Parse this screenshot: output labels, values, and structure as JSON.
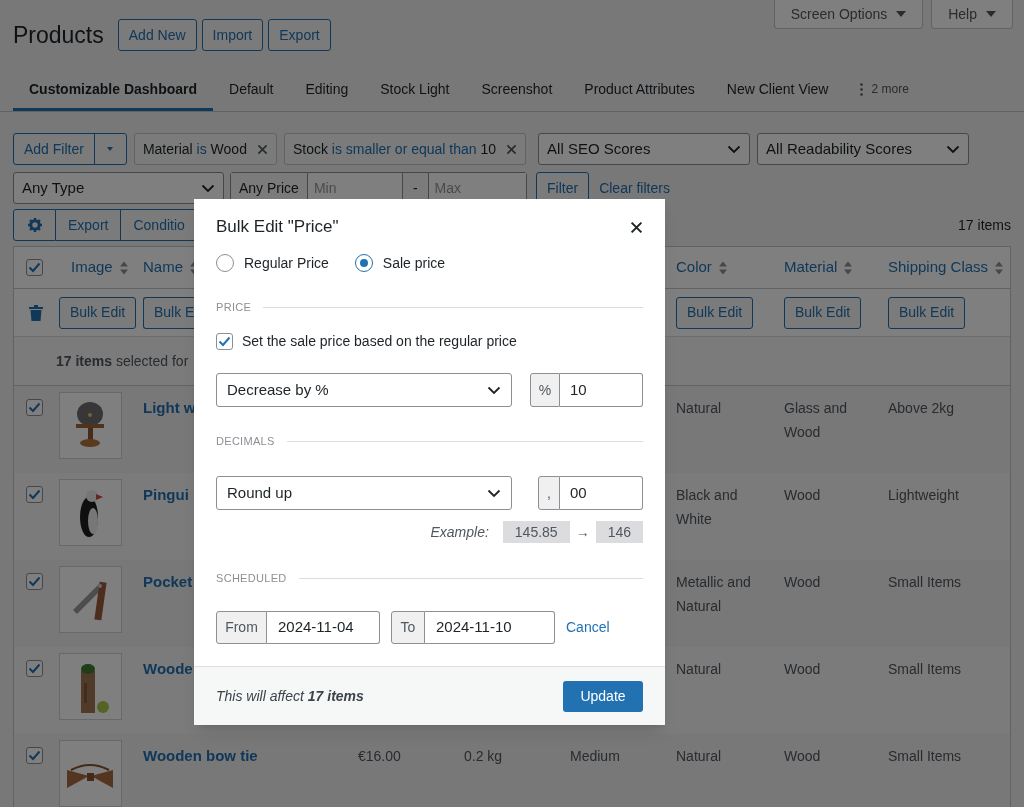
{
  "page_title": "Products",
  "header_buttons": [
    "Add New",
    "Import",
    "Export"
  ],
  "screen_meta_buttons": [
    "Screen Options",
    "Help"
  ],
  "tabs": [
    {
      "label": "Customizable Dashboard",
      "selected": true
    },
    {
      "label": "Default",
      "selected": false
    },
    {
      "label": "Editing",
      "selected": false
    },
    {
      "label": "Stock Light",
      "selected": false
    },
    {
      "label": "Screenshot",
      "selected": false
    },
    {
      "label": "Product Attributes",
      "selected": false
    },
    {
      "label": "New Client View",
      "selected": false
    }
  ],
  "more_tabs": "2 more",
  "filters": {
    "add_filter": "Add Filter",
    "chips": [
      {
        "field": "Material",
        "operator": "is",
        "value": "Wood"
      },
      {
        "field": "Stock",
        "operator": "is smaller or equal than",
        "value": "10"
      }
    ],
    "selects": [
      "All SEO Scores",
      "All Readability Scores"
    ],
    "type_select": "Any Type",
    "price": {
      "label": "Any Price",
      "min_placeholder": "Min",
      "separator": "-",
      "max_placeholder": "Max"
    },
    "filter_button": "Filter",
    "clear_link": "Clear filters"
  },
  "toolbar": {
    "buttons": [
      "Export",
      "Conditio"
    ],
    "count": "17 items"
  },
  "table": {
    "select_all_checked": true,
    "columns": [
      "Image",
      "Name",
      "Color",
      "Material",
      "Shipping Class"
    ],
    "bulk_buttons": [
      "Bulk Edit",
      "Bulk E",
      "Bulk Edit",
      "Bulk Edit",
      "Bulk Edit"
    ],
    "selection_note": "**17 items** selected for",
    "rows": [
      {
        "checked": true,
        "name": "Light w",
        "color_attribute": "Natural",
        "material": "Glass and Wood",
        "shipping_class": "Above 2kg"
      },
      {
        "checked": true,
        "name": "Pingui",
        "color_attribute": "Black and White",
        "material": "Wood",
        "shipping_class": "Lightweight"
      },
      {
        "checked": true,
        "name": "Pocket",
        "color_attribute": "Metallic and Natural",
        "material": "Wood",
        "shipping_class": "Small Items"
      },
      {
        "checked": true,
        "name": "Woode",
        "color_attribute": "Natural",
        "material": "Wood",
        "shipping_class": "Small Items"
      },
      {
        "checked": true,
        "name": "Wooden bow tie",
        "price": "€16.00",
        "weight": "0.2 kg",
        "size": "Medium",
        "color_attribute": "Natural",
        "material": "Wood",
        "shipping_class": "Small Items"
      }
    ]
  },
  "modal": {
    "title": "Bulk Edit \"Price\"",
    "target_options": [
      {
        "label": "Regular Price",
        "selected": false
      },
      {
        "label": "Sale price",
        "selected": true
      }
    ],
    "price_section": {
      "heading": "PRICE",
      "checkbox": {
        "label": "Set the sale price based on the regular price",
        "checked": true
      },
      "method": "Decrease by %",
      "addon": "%",
      "amount": "10"
    },
    "decimals_section": {
      "heading": "DECIMALS",
      "method": "Round up",
      "addon": ",",
      "digits": "00",
      "example_label": "Example:",
      "example_from": "145.85",
      "example_arrow": "→",
      "example_to": "146"
    },
    "scheduled_section": {
      "heading": "SCHEDULED",
      "from_label": "From",
      "from_value": "2024-11-04",
      "to_label": "To",
      "to_value": "2024-11-10",
      "cancel": "Cancel"
    },
    "footer": {
      "note": "This will affect **17 items**",
      "update": "Update"
    }
  }
}
